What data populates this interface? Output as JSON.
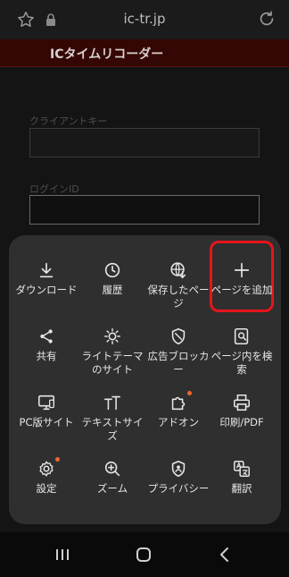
{
  "browser": {
    "url": "ic-tr.jp",
    "icons": [
      "star-icon",
      "lock-icon",
      "reload-icon"
    ]
  },
  "site": {
    "title": "ICタイムリコーダー",
    "client_key_label": "クライアントキー",
    "login_id_label": "ログインID"
  },
  "menu": {
    "items": [
      {
        "label": "ダウンロード",
        "icon": "download-icon"
      },
      {
        "label": "履歴",
        "icon": "history-icon"
      },
      {
        "label": "保存したページ",
        "icon": "saved-pages-icon"
      },
      {
        "label": "ページを追加",
        "icon": "plus-icon"
      },
      {
        "label": "共有",
        "icon": "share-icon"
      },
      {
        "label": "ライトテーマのサイト",
        "icon": "brightness-icon"
      },
      {
        "label": "広告ブロッカー",
        "icon": "shield-icon"
      },
      {
        "label": "ページ内を検索",
        "icon": "find-in-page-icon"
      },
      {
        "label": "PC版サイト",
        "icon": "desktop-icon"
      },
      {
        "label": "テキストサイズ",
        "icon": "text-size-icon"
      },
      {
        "label": "アドオン",
        "icon": "addon-icon"
      },
      {
        "label": "印刷/PDF",
        "icon": "print-icon"
      },
      {
        "label": "設定",
        "icon": "settings-icon"
      },
      {
        "label": "ズーム",
        "icon": "zoom-icon"
      },
      {
        "label": "プライバシー",
        "icon": "privacy-icon"
      },
      {
        "label": "翻訳",
        "icon": "translate-icon"
      }
    ],
    "highlight_color": "#e4161c",
    "notification_dot_color": "#f0662c"
  },
  "system_nav": {
    "icons": [
      "recent-apps-icon",
      "home-icon",
      "back-icon"
    ]
  }
}
